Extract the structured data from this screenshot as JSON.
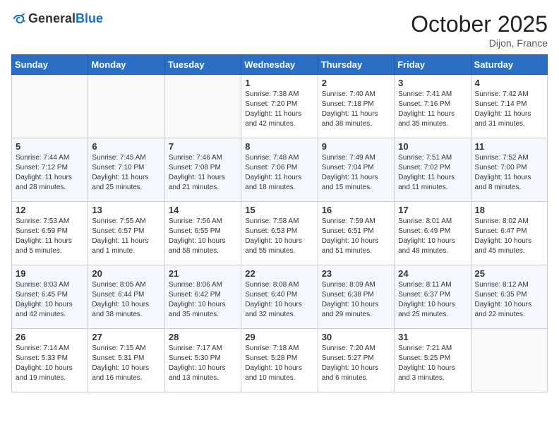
{
  "header": {
    "logo_general": "General",
    "logo_blue": "Blue",
    "month_year": "October 2025",
    "location": "Dijon, France"
  },
  "weekdays": [
    "Sunday",
    "Monday",
    "Tuesday",
    "Wednesday",
    "Thursday",
    "Friday",
    "Saturday"
  ],
  "weeks": [
    [
      {
        "day": "",
        "info": ""
      },
      {
        "day": "",
        "info": ""
      },
      {
        "day": "",
        "info": ""
      },
      {
        "day": "1",
        "info": "Sunrise: 7:38 AM\nSunset: 7:20 PM\nDaylight: 11 hours and 42 minutes."
      },
      {
        "day": "2",
        "info": "Sunrise: 7:40 AM\nSunset: 7:18 PM\nDaylight: 11 hours and 38 minutes."
      },
      {
        "day": "3",
        "info": "Sunrise: 7:41 AM\nSunset: 7:16 PM\nDaylight: 11 hours and 35 minutes."
      },
      {
        "day": "4",
        "info": "Sunrise: 7:42 AM\nSunset: 7:14 PM\nDaylight: 11 hours and 31 minutes."
      }
    ],
    [
      {
        "day": "5",
        "info": "Sunrise: 7:44 AM\nSunset: 7:12 PM\nDaylight: 11 hours and 28 minutes."
      },
      {
        "day": "6",
        "info": "Sunrise: 7:45 AM\nSunset: 7:10 PM\nDaylight: 11 hours and 25 minutes."
      },
      {
        "day": "7",
        "info": "Sunrise: 7:46 AM\nSunset: 7:08 PM\nDaylight: 11 hours and 21 minutes."
      },
      {
        "day": "8",
        "info": "Sunrise: 7:48 AM\nSunset: 7:06 PM\nDaylight: 11 hours and 18 minutes."
      },
      {
        "day": "9",
        "info": "Sunrise: 7:49 AM\nSunset: 7:04 PM\nDaylight: 11 hours and 15 minutes."
      },
      {
        "day": "10",
        "info": "Sunrise: 7:51 AM\nSunset: 7:02 PM\nDaylight: 11 hours and 11 minutes."
      },
      {
        "day": "11",
        "info": "Sunrise: 7:52 AM\nSunset: 7:00 PM\nDaylight: 11 hours and 8 minutes."
      }
    ],
    [
      {
        "day": "12",
        "info": "Sunrise: 7:53 AM\nSunset: 6:59 PM\nDaylight: 11 hours and 5 minutes."
      },
      {
        "day": "13",
        "info": "Sunrise: 7:55 AM\nSunset: 6:57 PM\nDaylight: 11 hours and 1 minute."
      },
      {
        "day": "14",
        "info": "Sunrise: 7:56 AM\nSunset: 6:55 PM\nDaylight: 10 hours and 58 minutes."
      },
      {
        "day": "15",
        "info": "Sunrise: 7:58 AM\nSunset: 6:53 PM\nDaylight: 10 hours and 55 minutes."
      },
      {
        "day": "16",
        "info": "Sunrise: 7:59 AM\nSunset: 6:51 PM\nDaylight: 10 hours and 51 minutes."
      },
      {
        "day": "17",
        "info": "Sunrise: 8:01 AM\nSunset: 6:49 PM\nDaylight: 10 hours and 48 minutes."
      },
      {
        "day": "18",
        "info": "Sunrise: 8:02 AM\nSunset: 6:47 PM\nDaylight: 10 hours and 45 minutes."
      }
    ],
    [
      {
        "day": "19",
        "info": "Sunrise: 8:03 AM\nSunset: 6:45 PM\nDaylight: 10 hours and 42 minutes."
      },
      {
        "day": "20",
        "info": "Sunrise: 8:05 AM\nSunset: 6:44 PM\nDaylight: 10 hours and 38 minutes."
      },
      {
        "day": "21",
        "info": "Sunrise: 8:06 AM\nSunset: 6:42 PM\nDaylight: 10 hours and 35 minutes."
      },
      {
        "day": "22",
        "info": "Sunrise: 8:08 AM\nSunset: 6:40 PM\nDaylight: 10 hours and 32 minutes."
      },
      {
        "day": "23",
        "info": "Sunrise: 8:09 AM\nSunset: 6:38 PM\nDaylight: 10 hours and 29 minutes."
      },
      {
        "day": "24",
        "info": "Sunrise: 8:11 AM\nSunset: 6:37 PM\nDaylight: 10 hours and 25 minutes."
      },
      {
        "day": "25",
        "info": "Sunrise: 8:12 AM\nSunset: 6:35 PM\nDaylight: 10 hours and 22 minutes."
      }
    ],
    [
      {
        "day": "26",
        "info": "Sunrise: 7:14 AM\nSunset: 5:33 PM\nDaylight: 10 hours and 19 minutes."
      },
      {
        "day": "27",
        "info": "Sunrise: 7:15 AM\nSunset: 5:31 PM\nDaylight: 10 hours and 16 minutes."
      },
      {
        "day": "28",
        "info": "Sunrise: 7:17 AM\nSunset: 5:30 PM\nDaylight: 10 hours and 13 minutes."
      },
      {
        "day": "29",
        "info": "Sunrise: 7:18 AM\nSunset: 5:28 PM\nDaylight: 10 hours and 10 minutes."
      },
      {
        "day": "30",
        "info": "Sunrise: 7:20 AM\nSunset: 5:27 PM\nDaylight: 10 hours and 6 minutes."
      },
      {
        "day": "31",
        "info": "Sunrise: 7:21 AM\nSunset: 5:25 PM\nDaylight: 10 hours and 3 minutes."
      },
      {
        "day": "",
        "info": ""
      }
    ]
  ]
}
